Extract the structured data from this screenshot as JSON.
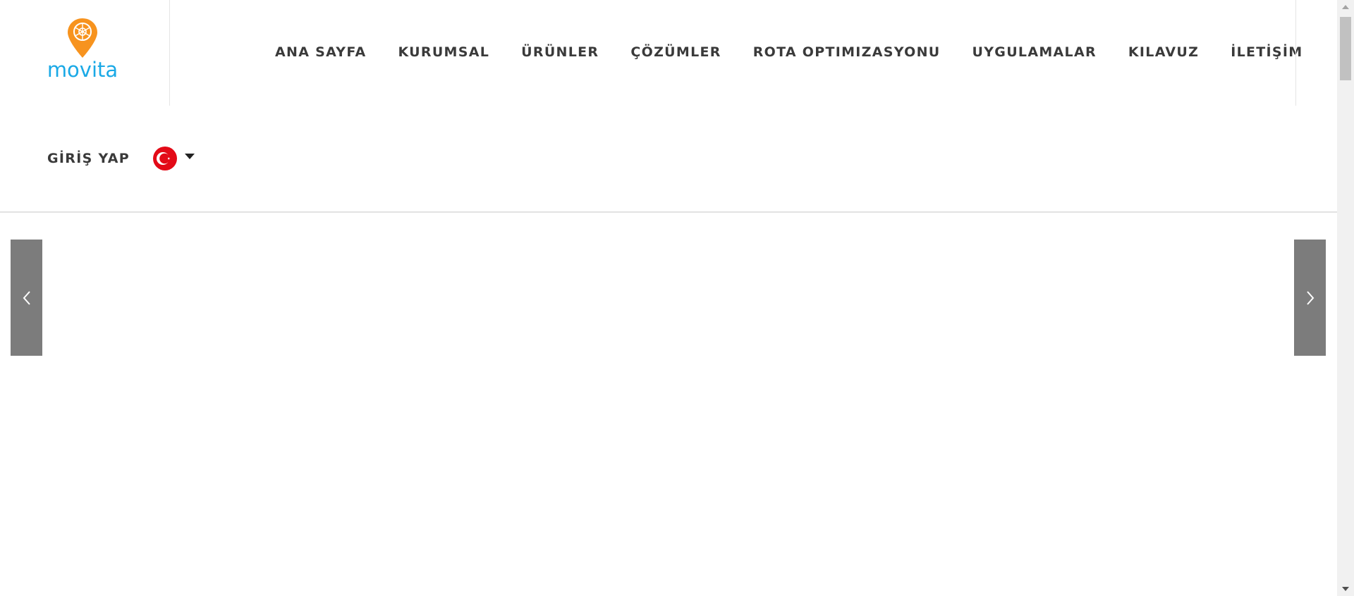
{
  "brand": {
    "name": "movita",
    "pin_color": "#f7931e",
    "text_color": "#1aa9e6"
  },
  "nav": {
    "items": [
      {
        "label": "ANA SAYFA"
      },
      {
        "label": "KURUMSAL"
      },
      {
        "label": "ÜRÜNLER"
      },
      {
        "label": "ÇÖZÜMLER"
      },
      {
        "label": "ROTA OPTIMIZASYONU"
      },
      {
        "label": "UYGULAMALAR"
      },
      {
        "label": "KILAVUZ"
      },
      {
        "label": "İLETİŞİM"
      }
    ]
  },
  "account": {
    "login_label": "GİRİŞ YAP",
    "language_icon": "turkey-flag-icon",
    "language_flag_color": "#e30a17"
  },
  "slider": {
    "prev_icon": "chevron-left-icon",
    "next_icon": "chevron-right-icon",
    "arrow_color": "#7c7c7c"
  },
  "scrollbar": {
    "up_icon": "scroll-up-arrow-icon",
    "down_icon": "scroll-down-arrow-icon"
  }
}
